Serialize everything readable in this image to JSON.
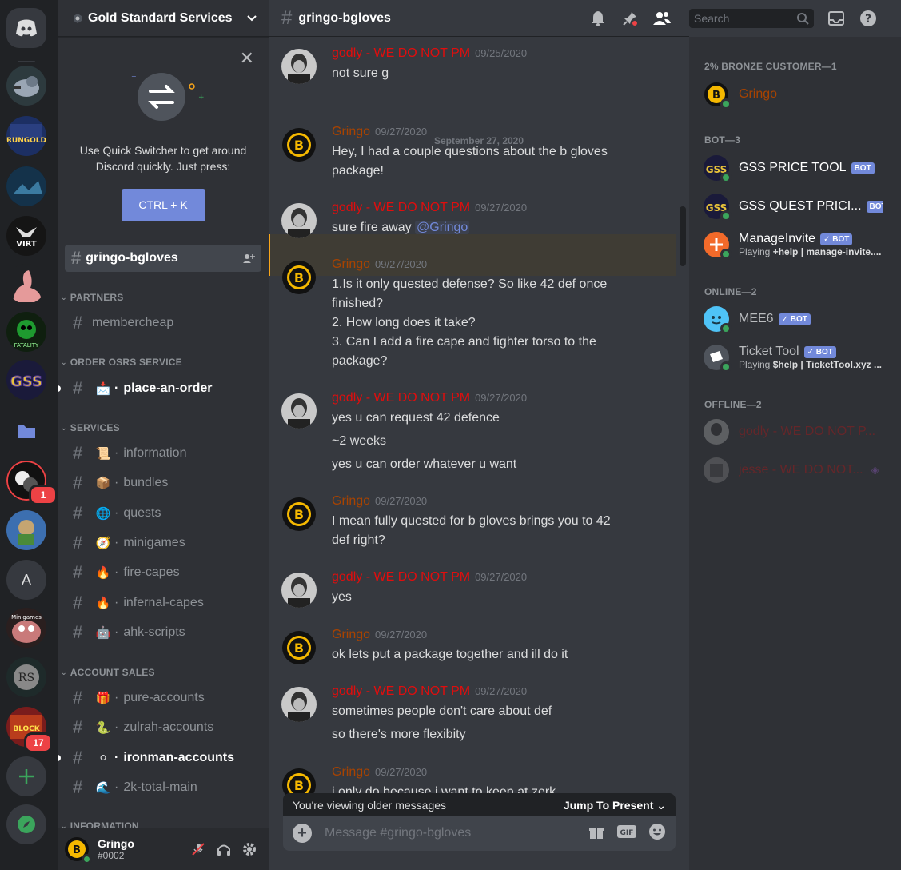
{
  "server": {
    "name": "Gold Standard Services",
    "home_icon": "discord-icon",
    "rail": [
      {
        "label": "",
        "badge": ""
      },
      {
        "label": "RUNGOLD",
        "badge": ""
      },
      {
        "label": "",
        "badge": ""
      },
      {
        "label": "VIRT",
        "badge": ""
      },
      {
        "label": "",
        "badge": ""
      },
      {
        "label": "FATALITY",
        "badge": ""
      },
      {
        "label": "GSS",
        "badge": ""
      },
      {
        "label": "",
        "badge": ""
      },
      {
        "label": "",
        "badge": "1"
      },
      {
        "label": "",
        "badge": ""
      },
      {
        "label": "A",
        "badge": ""
      },
      {
        "label": "Minigames",
        "badge": ""
      },
      {
        "label": "",
        "badge": ""
      },
      {
        "label": "",
        "badge": "17"
      }
    ]
  },
  "quick_switcher": {
    "text": "Use Quick Switcher to get around Discord quickly. Just press:",
    "shortcut": "CTRL + K"
  },
  "sidebar": {
    "selected_channel": "gringo-bgloves",
    "categories": [
      {
        "label": "PARTNERS",
        "channels": [
          {
            "name": "membercheap",
            "emoji": ""
          }
        ]
      },
      {
        "label": "ORDER OSRS SERVICE",
        "channels": [
          {
            "name": "place-an-order",
            "emoji": "📩"
          }
        ]
      },
      {
        "label": "SERVICES",
        "channels": [
          {
            "name": "information",
            "emoji": "📜"
          },
          {
            "name": "bundles",
            "emoji": "📦"
          },
          {
            "name": "quests",
            "emoji": "🌐"
          },
          {
            "name": "minigames",
            "emoji": "🧭"
          },
          {
            "name": "fire-capes",
            "emoji": "🔥"
          },
          {
            "name": "infernal-capes",
            "emoji": "🔥"
          },
          {
            "name": "ahk-scripts",
            "emoji": "🤖"
          }
        ]
      },
      {
        "label": "ACCOUNT SALES",
        "channels": [
          {
            "name": "pure-accounts",
            "emoji": "🎁"
          },
          {
            "name": "zulrah-accounts",
            "emoji": "🐍"
          },
          {
            "name": "ironman-accounts",
            "emoji": "⚪"
          },
          {
            "name": "2k-total-main",
            "emoji": "🌊"
          }
        ]
      },
      {
        "label": "INFORMATION",
        "channels": []
      }
    ]
  },
  "user": {
    "name": "Gringo",
    "tag": "#0002"
  },
  "channel": {
    "title": "gringo-bgloves",
    "search_placeholder": "Search",
    "composer_placeholder": "Message #gringo-bgloves",
    "older_notice": "You're viewing older messages",
    "jump_label": "Jump To Present",
    "date_divider": "September 27, 2020"
  },
  "messages": [
    {
      "author": "godly - WE DO NOT PM",
      "time": "09/25/2020",
      "lines": [
        "not sure g"
      ]
    },
    {
      "author": "Gringo",
      "time": "09/27/2020",
      "lines": [
        "Hey, I had a couple questions about the b gloves package!"
      ]
    },
    {
      "author": "godly - WE DO NOT PM",
      "time": "09/27/2020",
      "lines": [
        "sure fire away "
      ],
      "mention": "@Gringo"
    },
    {
      "author": "Gringo",
      "time": "09/27/2020",
      "lines": [
        "1.Is it only quested defense? So like 42 def once finished?",
        "2. How long does it take?",
        "3. Can I add a fire cape and fighter torso to the package?"
      ]
    },
    {
      "author": "godly - WE DO NOT PM",
      "time": "09/27/2020",
      "lines": [
        "yes u can request 42 defence",
        "~2 weeks",
        "yes u can order whatever u want"
      ]
    },
    {
      "author": "Gringo",
      "time": "09/27/2020",
      "lines": [
        "I mean fully quested for b gloves brings you to 42 def right?"
      ]
    },
    {
      "author": "godly - WE DO NOT PM",
      "time": "09/27/2020",
      "lines": [
        "yes"
      ]
    },
    {
      "author": "Gringo",
      "time": "09/27/2020",
      "lines": [
        "ok lets put a package together and ill do it"
      ]
    },
    {
      "author": "godly - WE DO NOT PM",
      "time": "09/27/2020",
      "lines": [
        "sometimes people don't care about def",
        "so there's more flexibity"
      ]
    },
    {
      "author": "Gringo",
      "time": "09/27/2020",
      "lines": [
        "i only do because i want to keep at zerk"
      ]
    }
  ],
  "members": {
    "groups": [
      {
        "label": "2% BRONZE CUSTOMER—1"
      },
      {
        "label": "BOT—3"
      },
      {
        "label": "ONLINE—2"
      },
      {
        "label": "OFFLINE—2"
      }
    ],
    "list": [
      {
        "name": "Gringo",
        "badge": "",
        "sub": ""
      },
      {
        "name": "GSS PRICE TOOL",
        "badge": "BOT",
        "sub": ""
      },
      {
        "name": "GSS QUEST PRICI...",
        "badge": "BOT",
        "sub": ""
      },
      {
        "name": "ManageInvite",
        "badge": "✓ BOT",
        "sub_prefix": "Playing ",
        "sub": "+help | manage-invite...."
      },
      {
        "name": "MEE6",
        "badge": "✓ BOT",
        "sub": ""
      },
      {
        "name": "Ticket Tool",
        "badge": "✓ BOT",
        "sub_prefix": "Playing ",
        "sub": "$help | TicketTool.xyz ..."
      },
      {
        "name": "godly - WE DO NOT P...",
        "badge": "",
        "sub": ""
      },
      {
        "name": "jesse - WE DO NOT...",
        "badge": "",
        "sub": ""
      }
    ]
  },
  "colors": {
    "accent": "#7289da",
    "red_role": "#e10d0d",
    "brown_role": "#a84300",
    "online": "#3ba55c"
  }
}
